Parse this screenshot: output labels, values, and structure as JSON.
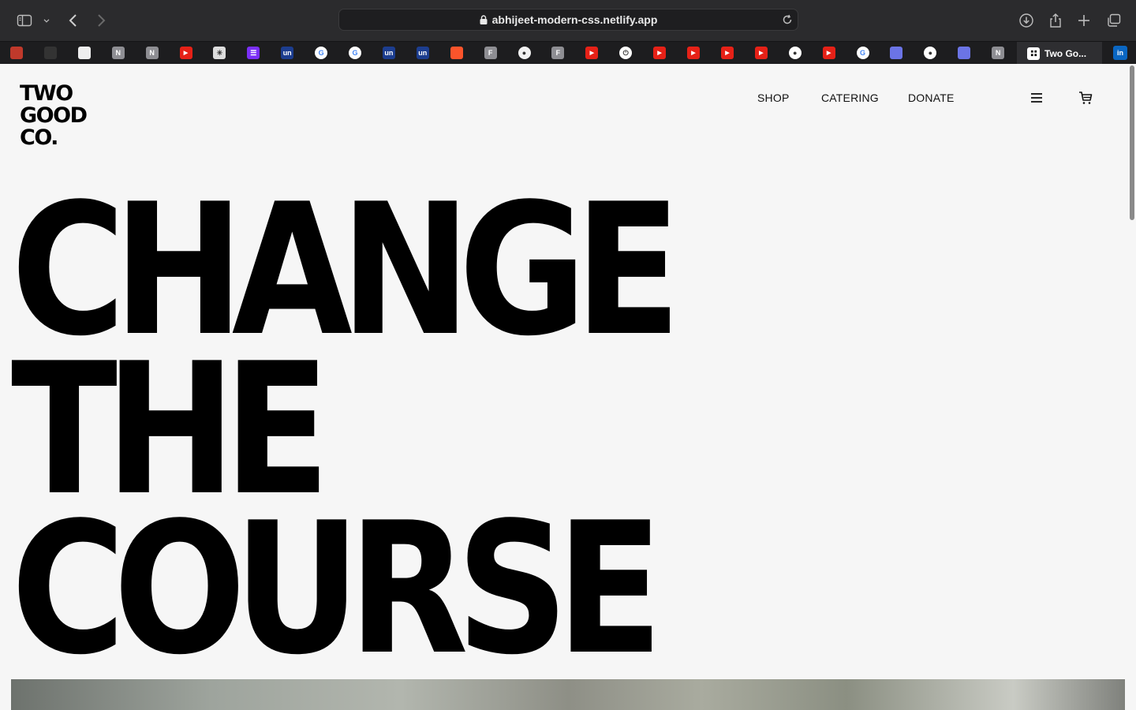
{
  "browser": {
    "url": "abhijeet-modern-css.netlify.app",
    "active_tab_title": "Two Go...",
    "tab_favicons": [
      {
        "name": "cube-favicon",
        "glyph": "",
        "color": "#c0392b"
      },
      {
        "name": "list-favicon",
        "glyph": "",
        "color": "#333333"
      },
      {
        "name": "dice-favicon",
        "glyph": "",
        "color": "#eeeeee"
      },
      {
        "name": "notion-favicon",
        "glyph": "N",
        "color": "#8e8e93"
      },
      {
        "name": "notion-favicon",
        "glyph": "N",
        "color": "#8e8e93"
      },
      {
        "name": "youtube-favicon",
        "glyph": "▶",
        "color": "#e62117"
      },
      {
        "name": "star-favicon",
        "glyph": "✳",
        "color": "#dddddd"
      },
      {
        "name": "form-favicon",
        "glyph": "☰",
        "color": "#7b2ff7"
      },
      {
        "name": "unstop-favicon",
        "glyph": "un",
        "color": "#1c3d8f"
      },
      {
        "name": "google-favicon",
        "glyph": "G",
        "color": "#ffffff"
      },
      {
        "name": "google-favicon",
        "glyph": "G",
        "color": "#ffffff"
      },
      {
        "name": "unstop-favicon",
        "glyph": "un",
        "color": "#1c3d8f"
      },
      {
        "name": "unstop-favicon",
        "glyph": "un",
        "color": "#1c3d8f"
      },
      {
        "name": "brave-favicon",
        "glyph": "",
        "color": "#fb542b"
      },
      {
        "name": "f-favicon",
        "glyph": "F",
        "color": "#8e8e93"
      },
      {
        "name": "circle-favicon",
        "glyph": "●",
        "color": "#f2f2f2"
      },
      {
        "name": "f-favicon",
        "glyph": "F",
        "color": "#8e8e93"
      },
      {
        "name": "youtube-favicon",
        "glyph": "▶",
        "color": "#e62117"
      },
      {
        "name": "power-favicon",
        "glyph": "⏻",
        "color": "#ffffff"
      },
      {
        "name": "youtube-favicon",
        "glyph": "▶",
        "color": "#e62117"
      },
      {
        "name": "youtube-favicon",
        "glyph": "▶",
        "color": "#e62117"
      },
      {
        "name": "youtube-favicon",
        "glyph": "▶",
        "color": "#e62117"
      },
      {
        "name": "youtube-favicon",
        "glyph": "▶",
        "color": "#e62117"
      },
      {
        "name": "github-favicon",
        "glyph": "●",
        "color": "#ffffff"
      },
      {
        "name": "youtube-favicon",
        "glyph": "▶",
        "color": "#e62117"
      },
      {
        "name": "google-favicon",
        "glyph": "G",
        "color": "#ffffff"
      },
      {
        "name": "chat-favicon",
        "glyph": "",
        "color": "#6b74e6"
      },
      {
        "name": "github-favicon",
        "glyph": "●",
        "color": "#ffffff"
      },
      {
        "name": "chat-favicon",
        "glyph": "",
        "color": "#6b74e6"
      },
      {
        "name": "notion-favicon",
        "glyph": "N",
        "color": "#8e8e93"
      }
    ],
    "pinned_right_tab": {
      "glyph": "in",
      "color": "#0a66c2"
    }
  },
  "site": {
    "logo_lines": [
      "TWO",
      "GOOD",
      "CO."
    ],
    "nav": {
      "shop": "SHOP",
      "catering": "CATERING",
      "donate": "DONATE"
    },
    "hero_lines": [
      "CHANGE",
      "THE",
      "COURSE"
    ]
  },
  "colors": {
    "page_bg": "#f6f6f6",
    "text": "#000000",
    "chrome_bg": "#2b2b2d",
    "tabstrip_bg": "#1d1d1f"
  }
}
